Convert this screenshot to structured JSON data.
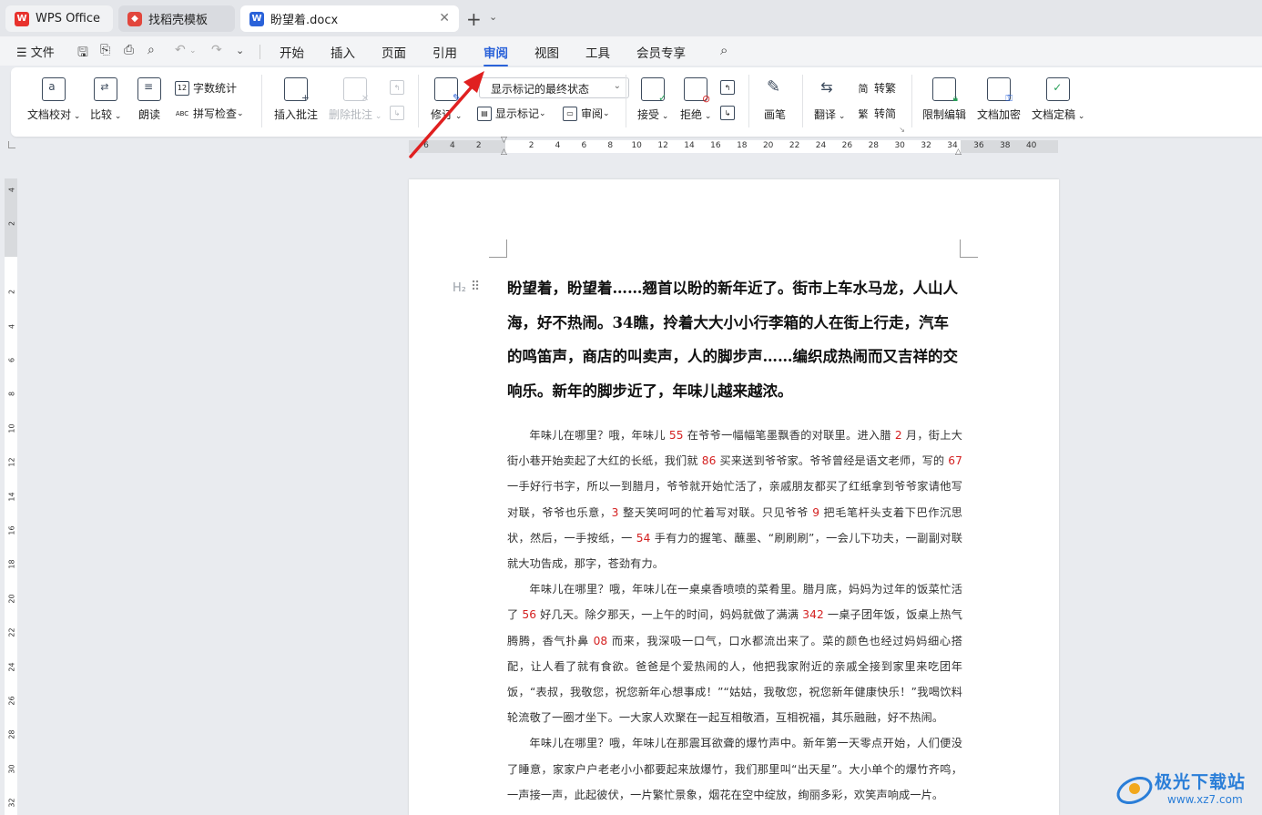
{
  "tabs": {
    "wps": "WPS Office",
    "template": "找稻壳模板",
    "doc": "盼望着.docx",
    "add": "+",
    "more": "⌄"
  },
  "menu": {
    "file": "☰ 文件",
    "tabs": [
      "开始",
      "插入",
      "页面",
      "引用",
      "审阅",
      "视图",
      "工具",
      "会员专享"
    ],
    "active": "审阅"
  },
  "ribbon": {
    "proofread": "文档校对",
    "compare": "比较",
    "read_aloud": "朗读",
    "word_count": "字数统计",
    "spell_check": "拼写检查",
    "insert_comment": "插入批注",
    "delete_comment": "删除批注",
    "track_changes": "修订",
    "markup_state": "显示标记的最终状态",
    "show_markup": "显示标记",
    "review": "审阅",
    "accept": "接受",
    "reject": "拒绝",
    "pen": "画笔",
    "translate": "翻译",
    "to_traditional": "转繁",
    "to_simplified": "转简",
    "restrict_edit": "限制编辑",
    "encrypt": "文档加密",
    "finalize": "文档定稿"
  },
  "ruler": {
    "h_ticks": [
      "6",
      "4",
      "2",
      "",
      "2",
      "4",
      "6",
      "8",
      "10",
      "12",
      "14",
      "16",
      "18",
      "20",
      "22",
      "24",
      "26",
      "28",
      "30",
      "32",
      "34",
      "36",
      "38",
      "40"
    ],
    "v_ticks": [
      "4",
      "2",
      "",
      "2",
      "4",
      "6",
      "8",
      "10",
      "12",
      "14",
      "16",
      "18",
      "20",
      "22",
      "24",
      "26",
      "28",
      "30",
      "32"
    ]
  },
  "document": {
    "heading_marker": "H₂",
    "heading": "盼望着，盼望着……翘首以盼的新年近了。街市上车水马龙，人山人海，好不热闹。34瞧，拎着大大小小行李箱的人在街上行走，汽车的鸣笛声，商店的叫卖声，人的脚步声……编织成热闹而又吉祥的交响乐。新年的脚步近了，年味儿越来越浓。",
    "paragraphs": [
      [
        {
          "t": "年味儿在哪里？哦，年味儿 "
        },
        {
          "t": "55",
          "n": true
        },
        {
          "t": " 在爷爷一幅幅笔墨飘香的对联里。进入腊 "
        },
        {
          "t": "2",
          "n": true
        },
        {
          "t": " 月，街上大街小巷开始卖起了大红的长纸，我们就 "
        },
        {
          "t": "86",
          "n": true
        },
        {
          "t": " 买来送到爷爷家。爷爷曾经是语文老师，写的 "
        },
        {
          "t": "67",
          "n": true
        },
        {
          "t": " 一手好行书字，所以一到腊月，爷爷就开始忙活了，亲戚朋友都买了红纸拿到爷爷家请他写对联，爷爷也乐意，"
        },
        {
          "t": "3",
          "n": true
        },
        {
          "t": " 整天笑呵呵的忙着写对联。只见爷爷 "
        },
        {
          "t": "9",
          "n": true
        },
        {
          "t": " 把毛笔杆头支着下巴作沉思状，然后，一手按纸，一 "
        },
        {
          "t": "54",
          "n": true
        },
        {
          "t": " 手有力的握笔、蘸墨、“刷刷刷”，一会儿下功夫，一副副对联就大功告成，那字，苍劲有力。"
        }
      ],
      [
        {
          "t": "年味儿在哪里？哦，年味儿在一桌桌香喷喷的菜肴里。腊月底，妈妈为过年的饭菜忙活了 "
        },
        {
          "t": "56",
          "n": true
        },
        {
          "t": " 好几天。除夕那天，一上午的时间，妈妈就做了满满 "
        },
        {
          "t": "342",
          "n": true
        },
        {
          "t": " 一桌子团年饭，饭桌上热气腾腾，香气扑鼻 "
        },
        {
          "t": "08",
          "n": true
        },
        {
          "t": " 而来，我深吸一口气，口水都流出来了。菜的颜色也经过妈妈细心搭配，让人看了就有食欲。爸爸是个爱热闹的人，他把我家附近的亲戚全接到家里来吃团年饭，“表叔，我敬您，祝您新年心想事成！”“姑姑，我敬您，祝您新年健康快乐！”我喝饮料轮流敬了一圈才坐下。一大家人欢聚在一起互相敬酒，互相祝福，其乐融融，好不热闹。"
        }
      ],
      [
        {
          "t": "年味儿在哪里？哦，年味儿在那震耳欲聋的爆竹声中。新年第一天零点开始，人们便没了睡意，家家户户老老小小都要起来放爆竹，我们那里叫“出天星”。大小单个的爆竹齐鸣，一声接一声，此起彼伏，一片繁忙景象，烟花在空中绽放，绚丽多彩，欢笑声响成一片。"
        }
      ]
    ]
  },
  "watermark": {
    "title": "极光下载站",
    "url": "www.xz7.com"
  },
  "colors": {
    "accent": "#2a62d9",
    "annotation_arrow": "#e02020",
    "number_highlight": "#d42020"
  }
}
